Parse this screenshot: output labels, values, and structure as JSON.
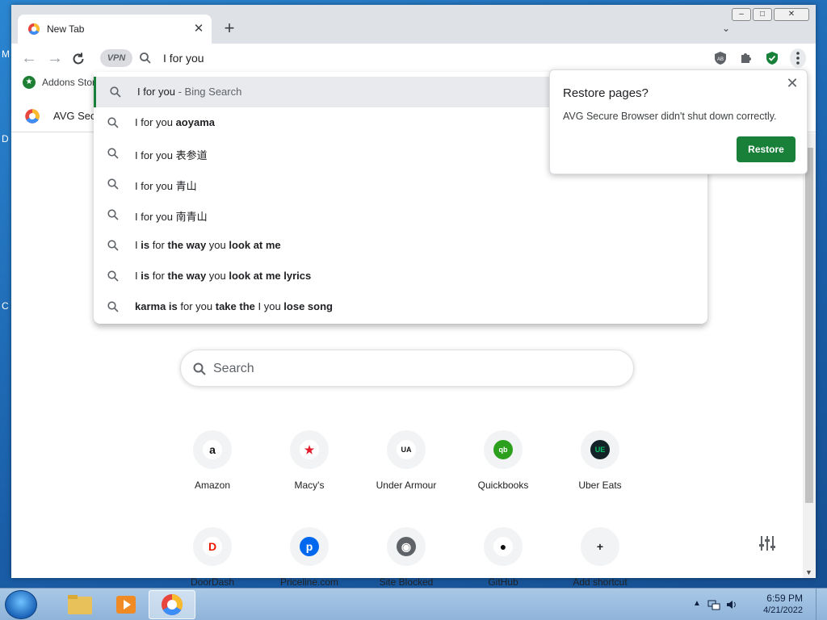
{
  "desktop": {
    "left_edge_fragments": [
      "M",
      "D",
      "C"
    ]
  },
  "browser": {
    "tab": {
      "title": "New Tab",
      "close_label": "✕"
    },
    "new_tab_label": "+",
    "window_controls": {
      "minimize": "–",
      "maximize": "□",
      "close": "✕"
    },
    "tab_search_label": "⌄",
    "omnibox": {
      "vpn_label": "VPN",
      "value": "I for you"
    },
    "bookmarks": [
      {
        "label": "Addons Store"
      }
    ],
    "infobar": {
      "text": "AVG Secure Browser"
    }
  },
  "suggestions": [
    {
      "parts": [
        [
          "I for you",
          0
        ],
        [
          " - Bing Search",
          2
        ]
      ]
    },
    {
      "parts": [
        [
          "I for you ",
          0
        ],
        [
          "aoyama",
          1
        ]
      ]
    },
    {
      "parts": [
        [
          "I for you 表参道",
          0
        ]
      ]
    },
    {
      "parts": [
        [
          "I for you 青山",
          0
        ]
      ]
    },
    {
      "parts": [
        [
          "I for you 南青山",
          0
        ]
      ]
    },
    {
      "parts": [
        [
          "I ",
          0
        ],
        [
          "is",
          1
        ],
        [
          " for ",
          0
        ],
        [
          "the way",
          1
        ],
        [
          " you ",
          0
        ],
        [
          "look at me",
          1
        ]
      ]
    },
    {
      "parts": [
        [
          "I ",
          0
        ],
        [
          "is",
          1
        ],
        [
          " for ",
          0
        ],
        [
          "the way",
          1
        ],
        [
          " you ",
          0
        ],
        [
          "look at me",
          1
        ],
        [
          " ",
          0
        ],
        [
          "lyrics",
          1
        ]
      ]
    },
    {
      "parts": [
        [
          "karma is",
          1
        ],
        [
          " for you ",
          0
        ],
        [
          "take the",
          1
        ],
        [
          " I you ",
          0
        ],
        [
          "lose song",
          1
        ]
      ]
    }
  ],
  "restore_popup": {
    "title": "Restore pages?",
    "message": "AVG Secure Browser didn't shut down correctly.",
    "button": "Restore",
    "close_label": "✕"
  },
  "ntp": {
    "search_placeholder": "Search",
    "shortcuts_row1": [
      {
        "label": "Amazon",
        "glyph": "a",
        "color": "#ffffff",
        "fg": "#111111"
      },
      {
        "label": "Macy's",
        "glyph": "★",
        "color": "#ffffff",
        "fg": "#e21a2c"
      },
      {
        "label": "Under Armour",
        "glyph": "UA",
        "color": "#ffffff",
        "fg": "#111111"
      },
      {
        "label": "Quickbooks",
        "glyph": "qb",
        "color": "#2ca01c",
        "fg": "#ffffff"
      },
      {
        "label": "Uber Eats",
        "glyph": "UE",
        "color": "#142328",
        "fg": "#06c167"
      }
    ],
    "shortcuts_row2": [
      {
        "label": "DoorDash",
        "glyph": "D",
        "color": "#ffffff",
        "fg": "#eb1700"
      },
      {
        "label": "Priceline.com",
        "glyph": "p",
        "color": "#0068ef",
        "fg": "#ffffff"
      },
      {
        "label": "Site Blocked",
        "glyph": "◉",
        "color": "#5f6368",
        "fg": "#ffffff"
      },
      {
        "label": "GitHub",
        "glyph": "●",
        "color": "#ffffff",
        "fg": "#111111"
      },
      {
        "label": "Add shortcut",
        "glyph": "+",
        "color": "#f1f3f4",
        "fg": "#202124"
      }
    ]
  },
  "taskbar": {
    "time": "6:59 PM",
    "date": "4/21/2022"
  }
}
